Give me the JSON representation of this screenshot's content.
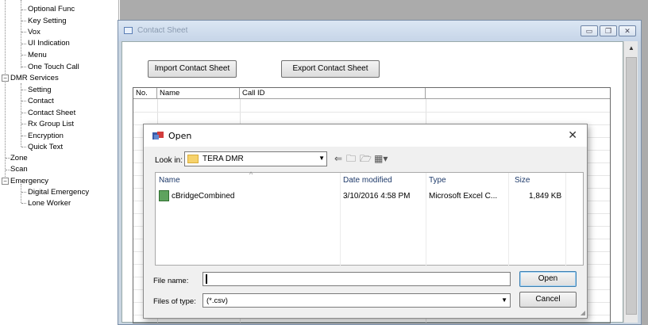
{
  "tree": {
    "items": [
      {
        "label": "Optional Func"
      },
      {
        "label": "Key Setting"
      },
      {
        "label": "Vox"
      },
      {
        "label": "UI Indication"
      },
      {
        "label": "Menu"
      },
      {
        "label": "One Touch Call"
      },
      {
        "label": "DMR Services"
      },
      {
        "label": "Setting"
      },
      {
        "label": "Contact"
      },
      {
        "label": "Contact Sheet"
      },
      {
        "label": "Rx Group List"
      },
      {
        "label": "Encryption"
      },
      {
        "label": "Quick Text"
      },
      {
        "label": "Zone"
      },
      {
        "label": "Scan"
      },
      {
        "label": "Emergency"
      },
      {
        "label": "Digital Emergency"
      },
      {
        "label": "Lone Worker"
      }
    ]
  },
  "contact_sheet": {
    "title": "Contact Sheet",
    "import_label": "Import Contact Sheet",
    "export_label": "Export Contact Sheet",
    "columns": [
      "No.",
      "Name",
      "Call ID",
      ""
    ]
  },
  "dialog": {
    "title": "Open",
    "look_in_label": "Look in:",
    "look_in_value": "TERA DMR",
    "columns": {
      "name": "Name",
      "date": "Date modified",
      "type": "Type",
      "size": "Size"
    },
    "files": [
      {
        "name": "cBridgeCombined",
        "date": "3/10/2016 4:58 PM",
        "type": "Microsoft Excel C...",
        "size": "1,849 KB"
      }
    ],
    "file_name_label": "File name:",
    "file_name_value": "",
    "files_of_type_label": "Files of type:",
    "files_of_type_value": "(*.csv)",
    "open_label": "Open",
    "cancel_label": "Cancel"
  }
}
